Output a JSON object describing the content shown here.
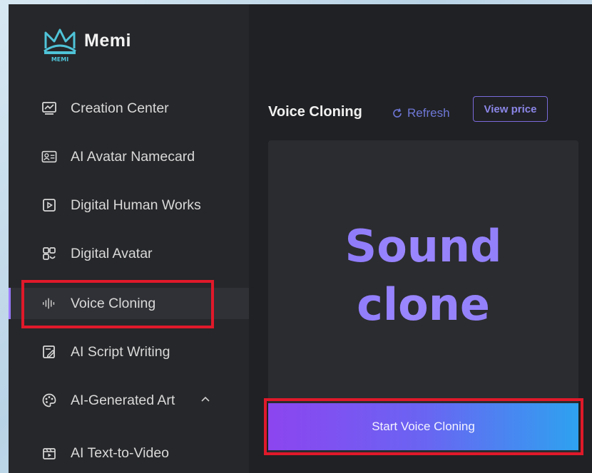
{
  "app": {
    "name": "Memi",
    "logo_caption": "MEMI"
  },
  "sidebar": {
    "items": [
      {
        "label": "Creation Center",
        "icon": "monitor-chart-icon"
      },
      {
        "label": "AI Avatar Namecard",
        "icon": "id-card-icon"
      },
      {
        "label": "Digital Human Works",
        "icon": "play-square-icon"
      },
      {
        "label": "Digital Avatar",
        "icon": "avatar-grid-icon"
      },
      {
        "label": "Voice Cloning",
        "icon": "sound-wave-icon",
        "active": true
      },
      {
        "label": "AI Script Writing",
        "icon": "script-edit-icon"
      },
      {
        "label": "AI-Generated Art",
        "icon": "palette-icon",
        "expanded": true
      },
      {
        "label": "AI Text-to-Video",
        "icon": "video-clapper-icon"
      }
    ]
  },
  "main": {
    "title": "Voice Cloning",
    "refresh_label": "Refresh",
    "view_price_label": "View price",
    "card": {
      "line1": "Sound",
      "line2": "clone"
    },
    "start_button_label": "Start Voice Cloning"
  },
  "colors": {
    "accent_purple": "#8c45f0",
    "accent_blue": "#2ea2f0",
    "highlight_red": "#e0192a",
    "sidebar_bg": "#26272a",
    "main_bg": "#202124"
  }
}
